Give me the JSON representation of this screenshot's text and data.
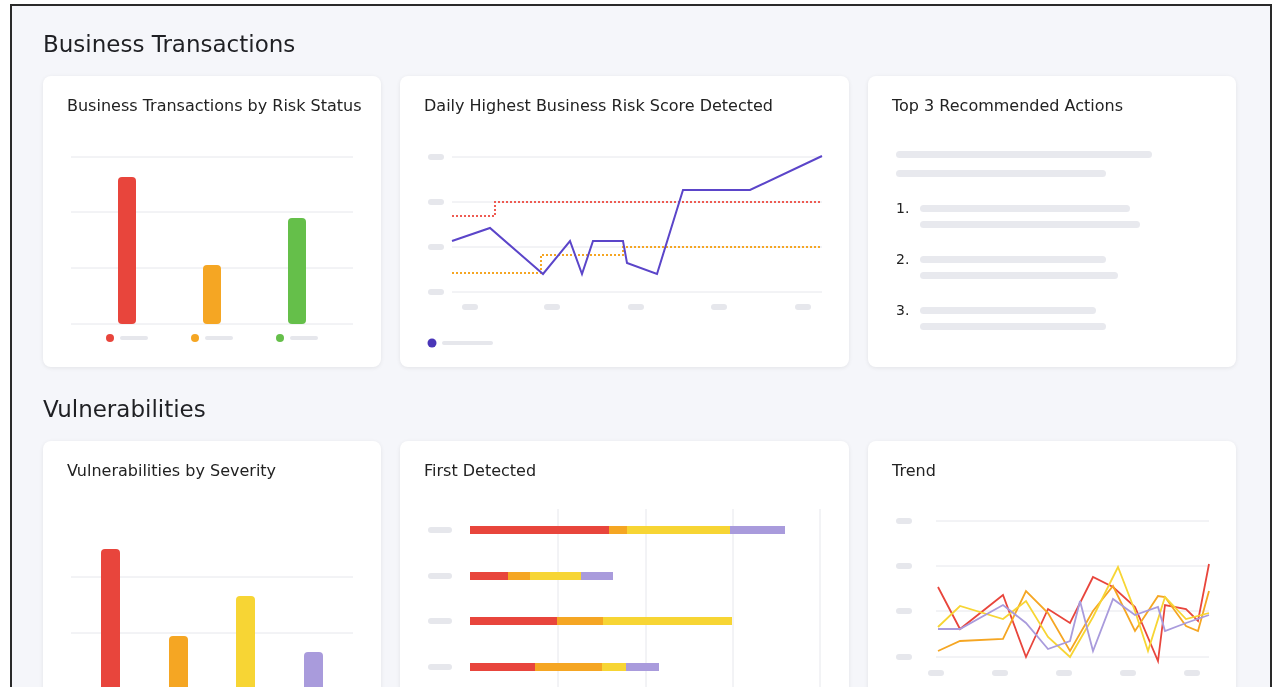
{
  "sections": [
    {
      "title": "Business Transactions",
      "cards": [
        {
          "kind": "risk_bars",
          "title": "Business Transactions by Risk Status"
        },
        {
          "kind": "risk_line",
          "title": "Daily Highest Business Risk Score Detected"
        },
        {
          "kind": "actions",
          "title": "Top 3 Recommended Actions",
          "items": [
            "1.",
            "2.",
            "3."
          ]
        }
      ]
    },
    {
      "title": "Vulnerabilities",
      "cards": [
        {
          "kind": "severity_bars",
          "title": "Vulnerabilities by Severity"
        },
        {
          "kind": "hbars",
          "title": "First Detected"
        },
        {
          "kind": "trend",
          "title": "Trend"
        }
      ]
    }
  ]
}
